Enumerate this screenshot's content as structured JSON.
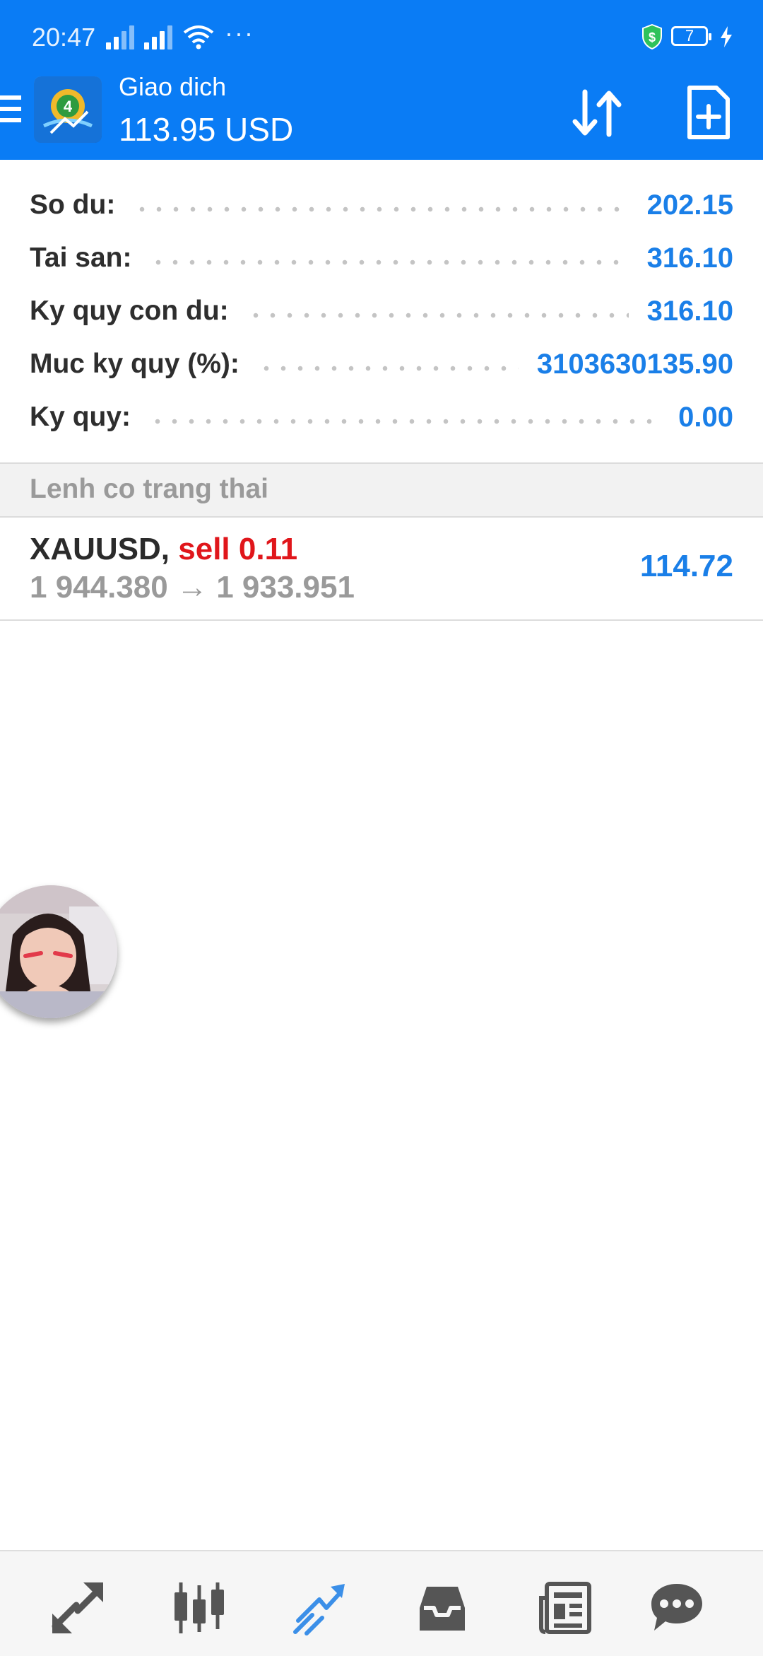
{
  "status_bar": {
    "time": "20:47",
    "overflow": "···",
    "battery_level": "7"
  },
  "header": {
    "title": "Giao dich",
    "subtitle": "113.95 USD",
    "accent_color": "#0a7cf5"
  },
  "account": {
    "rows": [
      {
        "label": "So du:",
        "value": "202.15"
      },
      {
        "label": "Tai san:",
        "value": "316.10"
      },
      {
        "label": "Ky quy con du:",
        "value": "316.10"
      },
      {
        "label": "Muc ky quy (%):",
        "value": "3103630135.90"
      },
      {
        "label": "Ky quy:",
        "value": "0.00"
      }
    ]
  },
  "positions": {
    "section_title": "Lenh co trang thai",
    "items": [
      {
        "symbol": "XAUUSD,",
        "side": "sell 0.11",
        "prices": "1 944.380 → 1 933.951",
        "profit": "114.72"
      }
    ]
  },
  "bottom_nav": {
    "items": [
      {
        "icon": "quotes-icon",
        "active": false
      },
      {
        "icon": "chart-icon",
        "active": false
      },
      {
        "icon": "trade-icon",
        "active": true
      },
      {
        "icon": "history-icon",
        "active": false
      },
      {
        "icon": "news-icon",
        "active": false
      },
      {
        "icon": "chat-icon",
        "active": false
      }
    ],
    "active_color": "#3b8fe8",
    "inactive_color": "#555555"
  }
}
